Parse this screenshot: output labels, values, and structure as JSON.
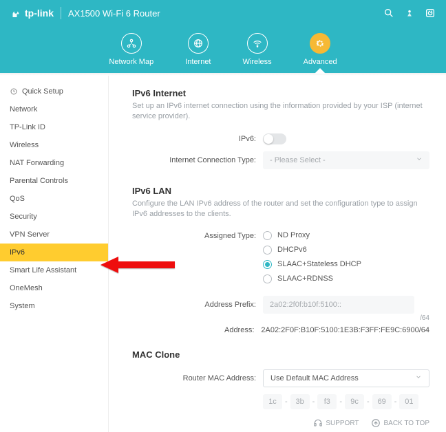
{
  "header": {
    "brand": "tp-link",
    "model": "AX1500 Wi-Fi 6 Router",
    "tabs": [
      {
        "label": "Network Map"
      },
      {
        "label": "Internet"
      },
      {
        "label": "Wireless"
      },
      {
        "label": "Advanced"
      }
    ]
  },
  "sidebar": {
    "items": [
      {
        "label": "Quick Setup",
        "icon": true
      },
      {
        "label": "Network"
      },
      {
        "label": "TP-Link ID"
      },
      {
        "label": "Wireless"
      },
      {
        "label": "NAT Forwarding"
      },
      {
        "label": "Parental Controls"
      },
      {
        "label": "QoS"
      },
      {
        "label": "Security"
      },
      {
        "label": "VPN Server"
      },
      {
        "label": "IPv6",
        "active": true
      },
      {
        "label": "Smart Life Assistant"
      },
      {
        "label": "OneMesh"
      },
      {
        "label": "System"
      }
    ]
  },
  "ipv6_internet": {
    "title": "IPv6 Internet",
    "desc": "Set up an IPv6 internet connection using the information provided by your ISP (internet service provider).",
    "ipv6_label": "IPv6:",
    "conn_type_label": "Internet Connection Type:",
    "conn_type_placeholder": "- Please Select -"
  },
  "ipv6_lan": {
    "title": "IPv6 LAN",
    "desc": "Configure the LAN IPv6 address of the router and set the configuration type to assign IPv6 addresses to the clients.",
    "assigned_type_label": "Assigned Type:",
    "options": [
      {
        "label": "ND Proxy",
        "selected": false
      },
      {
        "label": "DHCPv6",
        "selected": false
      },
      {
        "label": "SLAAC+Stateless DHCP",
        "selected": true
      },
      {
        "label": "SLAAC+RDNSS",
        "selected": false
      }
    ],
    "address_prefix_label": "Address Prefix:",
    "address_prefix_value": "2a02:2f0f:b10f:5100::",
    "address_prefix_suffix": "/64",
    "address_label": "Address:",
    "address_value": "2A02:2F0F:B10F:5100:1E3B:F3FF:FE9C:6900/64"
  },
  "mac_clone": {
    "title": "MAC Clone",
    "router_mac_label": "Router MAC Address:",
    "router_mac_value": "Use Default MAC Address",
    "octets": [
      "1c",
      "3b",
      "f3",
      "9c",
      "69",
      "01"
    ]
  },
  "footer": {
    "support": "SUPPORT",
    "backtotop": "BACK TO TOP"
  }
}
